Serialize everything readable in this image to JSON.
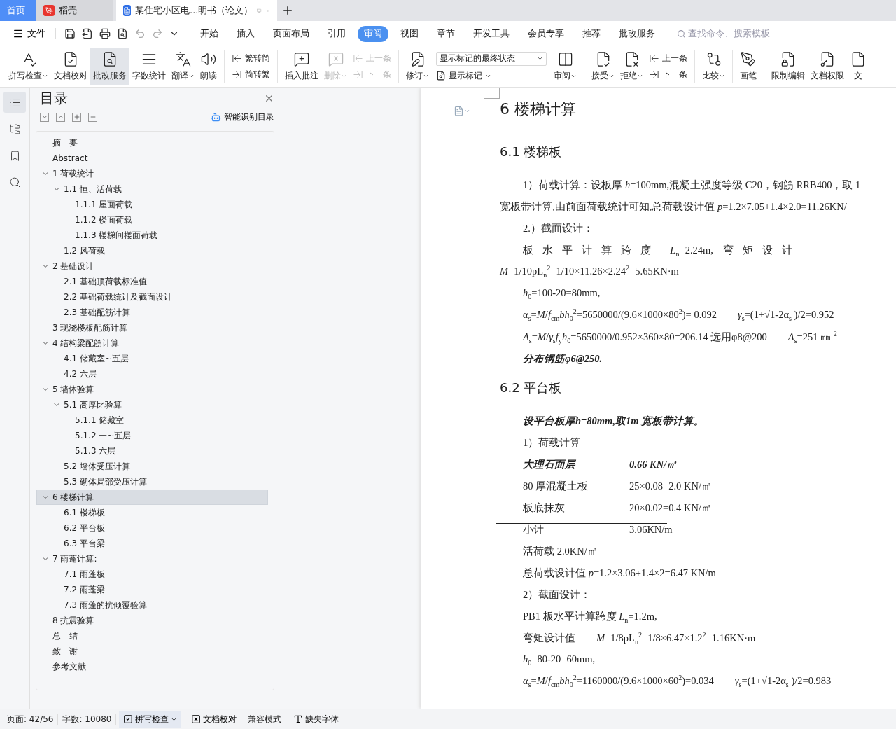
{
  "app_tabs": [
    {
      "kind": "home",
      "label": "首页",
      "selected": false
    },
    {
      "kind": "docer",
      "label": "稻壳",
      "selected": false
    },
    {
      "kind": "doc",
      "label": "某住宅小区电...明书（论文）",
      "selected": true
    }
  ],
  "menu": {
    "file": "文件",
    "tabs": [
      {
        "label": "开始",
        "selected": false
      },
      {
        "label": "插入",
        "selected": false
      },
      {
        "label": "页面布局",
        "selected": false
      },
      {
        "label": "引用",
        "selected": false
      },
      {
        "label": "审阅",
        "selected": true
      },
      {
        "label": "视图",
        "selected": false
      },
      {
        "label": "章节",
        "selected": false
      },
      {
        "label": "开发工具",
        "selected": false
      },
      {
        "label": "会员专享",
        "selected": false
      },
      {
        "label": "推荐",
        "selected": false
      },
      {
        "label": "批改服务",
        "selected": false
      }
    ],
    "search": {
      "placeholder": "查找命令、搜索模板"
    }
  },
  "ribbon": [
    {
      "kind": "big",
      "label": "拼写检查",
      "dropdown": true,
      "active": false,
      "disabled": false
    },
    {
      "kind": "big",
      "label": "文档校对",
      "dropdown": false,
      "active": false,
      "disabled": false
    },
    {
      "kind": "big",
      "label": "批改服务",
      "dropdown": false,
      "active": true,
      "disabled": false
    },
    {
      "kind": "big",
      "label": "字数统计",
      "dropdown": false,
      "active": false,
      "disabled": false
    },
    {
      "kind": "big",
      "label": "翻译",
      "dropdown": true,
      "active": false,
      "disabled": false
    },
    {
      "kind": "big",
      "label": "朗读",
      "dropdown": false,
      "active": false,
      "disabled": false
    },
    {
      "kind": "sep"
    },
    {
      "kind": "pair",
      "items": [
        {
          "label": "繁转简",
          "disabled": false
        },
        {
          "label": "简转繁",
          "disabled": false
        }
      ]
    },
    {
      "kind": "sep"
    },
    {
      "kind": "big",
      "label": "插入批注",
      "dropdown": false,
      "active": false,
      "disabled": false
    },
    {
      "kind": "big",
      "label": "删除",
      "dropdown": true,
      "active": false,
      "disabled": true
    },
    {
      "kind": "pair",
      "items": [
        {
          "label": "上一条",
          "disabled": true
        },
        {
          "label": "下一条",
          "disabled": true
        }
      ]
    },
    {
      "kind": "sep"
    },
    {
      "kind": "big",
      "label": "修订",
      "dropdown": true,
      "active": false,
      "disabled": false
    },
    {
      "kind": "select",
      "value": "显示标记的最终状态",
      "sub": "显示标记"
    },
    {
      "kind": "big",
      "label": "审阅",
      "dropdown": true,
      "active": false,
      "disabled": false
    },
    {
      "kind": "sep"
    },
    {
      "kind": "big",
      "label": "接受",
      "dropdown": true,
      "active": false,
      "disabled": false
    },
    {
      "kind": "big",
      "label": "拒绝",
      "dropdown": true,
      "active": false,
      "disabled": false
    },
    {
      "kind": "pair",
      "items": [
        {
          "label": "上一条",
          "disabled": false
        },
        {
          "label": "下一条",
          "disabled": false
        }
      ]
    },
    {
      "kind": "sep"
    },
    {
      "kind": "big",
      "label": "比较",
      "dropdown": true,
      "active": false,
      "disabled": false
    },
    {
      "kind": "sep"
    },
    {
      "kind": "big",
      "label": "画笔",
      "dropdown": false,
      "active": false,
      "disabled": false
    },
    {
      "kind": "sep"
    },
    {
      "kind": "big",
      "label": "限制编辑",
      "dropdown": false,
      "active": false,
      "disabled": false
    },
    {
      "kind": "big",
      "label": "文档权限",
      "dropdown": false,
      "active": false,
      "disabled": false
    },
    {
      "kind": "big",
      "label": "文",
      "dropdown": false,
      "active": false,
      "disabled": false
    }
  ],
  "rail": [
    {
      "selected": true
    },
    {
      "selected": false
    },
    {
      "selected": false
    },
    {
      "selected": false
    }
  ],
  "toc": {
    "title": "目录",
    "smart": "智能识别目录",
    "items": [
      {
        "label": "摘　要",
        "selected": false
      },
      {
        "label": "Abstract",
        "selected": false
      },
      {
        "label": "1  荷载统计",
        "selected": false,
        "expanded": true,
        "children": [
          {
            "label": "1.1 恒、活荷载",
            "selected": false,
            "expanded": true,
            "children": [
              {
                "label": "1.1.1 屋面荷载",
                "selected": false
              },
              {
                "label": "1.1.2  楼面荷载",
                "selected": false
              },
              {
                "label": "1.1.3  楼梯间楼面荷载",
                "selected": false
              }
            ]
          },
          {
            "label": "1.2  风荷载",
            "selected": false
          }
        ]
      },
      {
        "label": "2  基础设计",
        "selected": false,
        "expanded": true,
        "children": [
          {
            "label": "2.1  基础顶荷载标准值",
            "selected": false
          },
          {
            "label": "2.2  基础荷载统计及截面设计",
            "selected": false
          },
          {
            "label": "2.3  基础配筋计算",
            "selected": false
          }
        ]
      },
      {
        "label": "3  现浇楼板配筋计算",
        "selected": false
      },
      {
        "label": "4  结构梁配筋计算",
        "selected": false,
        "expanded": true,
        "children": [
          {
            "label": "4.1  储藏室~五层",
            "selected": false
          },
          {
            "label": "4.2  六层",
            "selected": false
          }
        ]
      },
      {
        "label": "5  墙体验算",
        "selected": false,
        "expanded": true,
        "children": [
          {
            "label": "5.1  高厚比验算",
            "selected": false,
            "expanded": true,
            "children": [
              {
                "label": "5.1.1 储藏室",
                "selected": false
              },
              {
                "label": "5.1.2  一~五层",
                "selected": false
              },
              {
                "label": "5.1.3  六层",
                "selected": false
              }
            ]
          },
          {
            "label": "5.2  墙体受压计算",
            "selected": false
          },
          {
            "label": "5.3  砌体局部受压计算",
            "selected": false
          }
        ]
      },
      {
        "label": "6  楼梯计算",
        "selected": true,
        "expanded": true,
        "children": [
          {
            "label": "6.1  楼梯板",
            "selected": false
          },
          {
            "label": "6.2  平台板",
            "selected": false
          },
          {
            "label": "6.3  平台梁",
            "selected": false
          }
        ]
      },
      {
        "label": "7  雨蓬计算:",
        "selected": false,
        "expanded": true,
        "children": [
          {
            "label": "7.1  雨蓬板",
            "selected": false
          },
          {
            "label": "7.2  雨蓬梁",
            "selected": false
          },
          {
            "label": "7.3  雨蓬的抗倾覆验算",
            "selected": false
          }
        ]
      },
      {
        "label": "8  抗震验算",
        "selected": false
      },
      {
        "label": "总　结",
        "selected": false
      },
      {
        "label": "致　谢",
        "selected": false
      },
      {
        "label": "参考文献",
        "selected": false
      }
    ]
  },
  "document": [
    {
      "kind": "h1",
      "parts": [
        "6  楼梯计算"
      ]
    },
    {
      "kind": "h2",
      "parts": [
        "6.1  楼梯板"
      ]
    },
    {
      "kind": "indent",
      "parts": [
        "1）荷载计算：设板厚 *h*=100mm,混凝土强度等级 C20，钢筋 RRB400，取 1"
      ]
    },
    {
      "kind": "plain",
      "parts": [
        "宽板带计算,由前面荷载统计可知,总荷载设计值 *p*=1.2×7.05+1.4×2.0=11.26KN/"
      ]
    },
    {
      "kind": "indent",
      "parts": [
        "2.）截面设计："
      ]
    },
    {
      "kind": "spaced",
      "parts": [
        "板水平计算跨度",
        "*L*$_{n}$=2.24m,",
        "弯矩设计"
      ]
    },
    {
      "kind": "plain",
      "parts": [
        "*M*=1/10pL$_{n}$$^{2}$=1/10×11.26×2.24$^{2}$=5.65KN·m"
      ]
    },
    {
      "kind": "indent",
      "parts": [
        "*h*$_{0}$=100-20=80mm,"
      ]
    },
    {
      "kind": "indent",
      "parts": [
        "*α*$_{s}$=*M*/*f*$_{cm}$*bh*$_{0}$$^{2}$=5650000/(9.6×1000×80$^{2}$)= 0.092",
        "*γ*$_{s}$=(1+√1-2α$_{s}$ )/2=0.952"
      ]
    },
    {
      "kind": "indent",
      "parts": [
        "*A*$_{s}$=*M*/*γ*$_{s}$*f*$_{y}$*h*$_{0}$=5650000/0.952×360×80=206.14 选用φ8@200",
        "*A*$_{s}$=251 ㎜ $^{2}$"
      ]
    },
    {
      "kind": "bold",
      "parts": [
        "分布钢筋φ6@250."
      ]
    },
    {
      "kind": "h2",
      "parts": [
        "6.2  平台板"
      ]
    },
    {
      "kind": "bold",
      "parts": [
        "设平台板厚h=80mm,取1m 宽板带计算。"
      ]
    },
    {
      "kind": "indent",
      "parts": [
        "1）荷载计算"
      ]
    },
    {
      "kind": "boldrow",
      "parts": [
        "大理石面层",
        "0.66 KN/㎡"
      ]
    },
    {
      "kind": "row",
      "parts": [
        "80 厚混凝土板",
        "25×0.08=2.0 KN/㎡"
      ]
    },
    {
      "kind": "row",
      "parts": [
        "板底抹灰",
        "20×0.02=0.4 KN/㎡"
      ]
    },
    {
      "kind": "rule"
    },
    {
      "kind": "row",
      "parts": [
        "小计",
        "3.06KN/m"
      ]
    },
    {
      "kind": "indent",
      "parts": [
        "活荷载 2.0KN/㎡"
      ]
    },
    {
      "kind": "indent",
      "parts": [
        "总荷载设计值 *p*=1.2×3.06+1.4×2=6.47 KN/m"
      ]
    },
    {
      "kind": "indent",
      "parts": [
        "2）截面设计："
      ]
    },
    {
      "kind": "indent",
      "parts": [
        "PB1 板水平计算跨度 *L*$_{n}$=1.2m,"
      ]
    },
    {
      "kind": "indent",
      "parts": [
        "弯矩设计值",
        "*M*=1/8pL$_{n}$$^{2}$=1/8×6.47×1.2$^{2}$=1.16KN·m"
      ]
    },
    {
      "kind": "indent",
      "parts": [
        "*h*$_{0}$=80-20=60mm,"
      ]
    },
    {
      "kind": "indent",
      "parts": [
        "*α*$_{s}$=*M*/*f*$_{cm}$*bh*$_{0}$$^{2}$=1160000/(9.6×1000×60$^{2}$)=0.034",
        "*γ*$_{s}$=(1+√1-2α$_{s}$ )/2=0.983"
      ]
    }
  ],
  "status_bar": [
    {
      "kind": "text",
      "label": "页面: 42/56"
    },
    {
      "kind": "text",
      "label": "字数: 10080"
    },
    {
      "kind": "spell",
      "label": "拼写检查"
    },
    {
      "kind": "proof",
      "label": "文档校对"
    },
    {
      "kind": "text",
      "label": "兼容模式"
    },
    {
      "kind": "font",
      "label": "缺失字体"
    }
  ]
}
